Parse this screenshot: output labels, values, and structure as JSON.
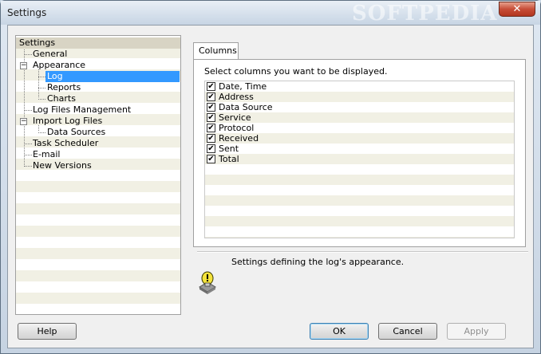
{
  "window": {
    "title": "Settings",
    "watermark": "SOFTPEDIA",
    "close_glyph": "✕"
  },
  "tree": {
    "items": [
      {
        "label": "Settings"
      },
      {
        "label": "General"
      },
      {
        "label": "Appearance",
        "expanded": true
      },
      {
        "label": "Log",
        "selected": true
      },
      {
        "label": "Reports"
      },
      {
        "label": "Charts"
      },
      {
        "label": "Log Files Management"
      },
      {
        "label": "Import Log Files",
        "expanded": true
      },
      {
        "label": "Data Sources"
      },
      {
        "label": "Task Scheduler"
      },
      {
        "label": "E-mail"
      },
      {
        "label": "New Versions"
      }
    ],
    "expand_glyph": "−"
  },
  "tab": {
    "label": "Columns",
    "instruction": "Select columns you want to be displayed.",
    "check_glyph": "✔",
    "columns": [
      {
        "label": "Date, Time",
        "checked": true
      },
      {
        "label": "Address",
        "checked": true
      },
      {
        "label": "Data Source",
        "checked": true
      },
      {
        "label": "Service",
        "checked": true
      },
      {
        "label": "Protocol",
        "checked": true
      },
      {
        "label": "Received",
        "checked": true
      },
      {
        "label": "Sent",
        "checked": true
      },
      {
        "label": "Total",
        "checked": true
      }
    ]
  },
  "description": {
    "text": "Settings defining the log's appearance.",
    "icon": "lightbulb-info-icon"
  },
  "buttons": {
    "help": "Help",
    "ok": "OK",
    "cancel": "Cancel",
    "apply": "Apply"
  }
}
